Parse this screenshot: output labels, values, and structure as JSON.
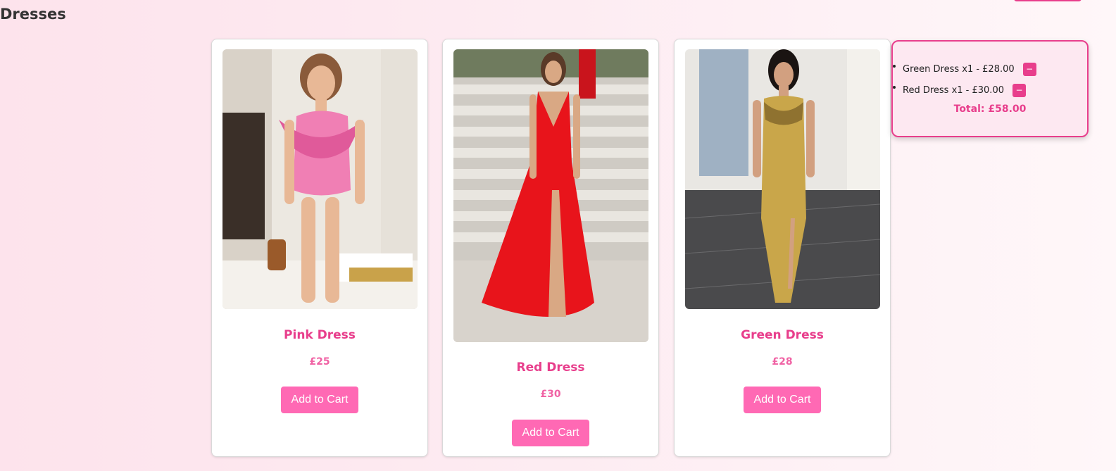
{
  "page": {
    "title": "Dresses"
  },
  "products": [
    {
      "name": "Pink Dress",
      "price": "£25",
      "button_label": "Add to Cart",
      "dress_color": "#f07fb4",
      "accent": "#e05a9a"
    },
    {
      "name": "Red Dress",
      "price": "£30",
      "button_label": "Add to Cart",
      "dress_color": "#e8141b",
      "accent": "#b50d12"
    },
    {
      "name": "Green Dress",
      "price": "£28",
      "button_label": "Add to Cart",
      "dress_color": "#c9a64a",
      "accent": "#8f7230"
    }
  ],
  "cart": {
    "items": [
      {
        "text": "Green Dress x1 - £28.00",
        "remove_label": "−"
      },
      {
        "text": "Red Dress x1 - £30.00",
        "remove_label": "−"
      }
    ],
    "total": "Total: £58.00"
  },
  "colors": {
    "accent": "#e83e8c",
    "button": "#ff69b4"
  }
}
